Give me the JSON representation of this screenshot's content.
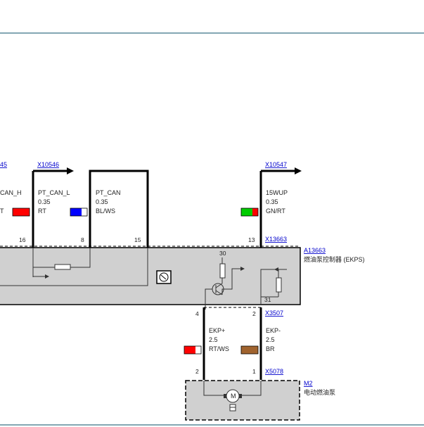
{
  "connectors": {
    "x10545_partial": "45",
    "x10546": "X10546",
    "x10547": "X10547",
    "x13663": "X13663",
    "x3507": "X3507",
    "x5078": "X5078"
  },
  "components": {
    "a13663": {
      "id": "A13663",
      "name": "燃油泵控制器 (EKPS)"
    },
    "m2": {
      "id": "M2",
      "name": "电动燃油泵"
    }
  },
  "wires": [
    {
      "key": "pt_can_h",
      "name": "CAN_H",
      "color_code": "T",
      "pin": "16",
      "swatch": [
        "#ff0000"
      ]
    },
    {
      "key": "pt_can_l",
      "name": "PT_CAN_L",
      "gauge": "0.35",
      "color_code": "RT",
      "pin": "8",
      "swatch": [
        "#0000ff",
        "#ffffff"
      ]
    },
    {
      "key": "pt_can",
      "name": "PT_CAN",
      "gauge": "0.35",
      "color_code": "BL/WS",
      "pin": "15"
    },
    {
      "key": "wup",
      "name": "15WUP",
      "gauge": "0.35",
      "color_code": "GN/RT",
      "pin": "13",
      "swatch": [
        "#00cc00",
        "#ff0000"
      ]
    },
    {
      "key": "ekp_plus",
      "name": "EKP+",
      "gauge": "2.5",
      "color_code": "RT/WS",
      "pin_top": "4",
      "pin_bottom": "2",
      "swatch": [
        "#ff0000",
        "#ffffff"
      ]
    },
    {
      "key": "ekp_minus",
      "name": "EKP-",
      "gauge": "2.5",
      "color_code": "BR",
      "pin_top": "2",
      "pin_bottom": "1",
      "swatch": [
        "#a0632e"
      ]
    }
  ],
  "internal_labels": {
    "supply": "30",
    "ground": "31"
  },
  "colors": {
    "accent_line": "#5a8a9a",
    "module_fill": "#d0d0d0",
    "link": "#0000cc"
  }
}
